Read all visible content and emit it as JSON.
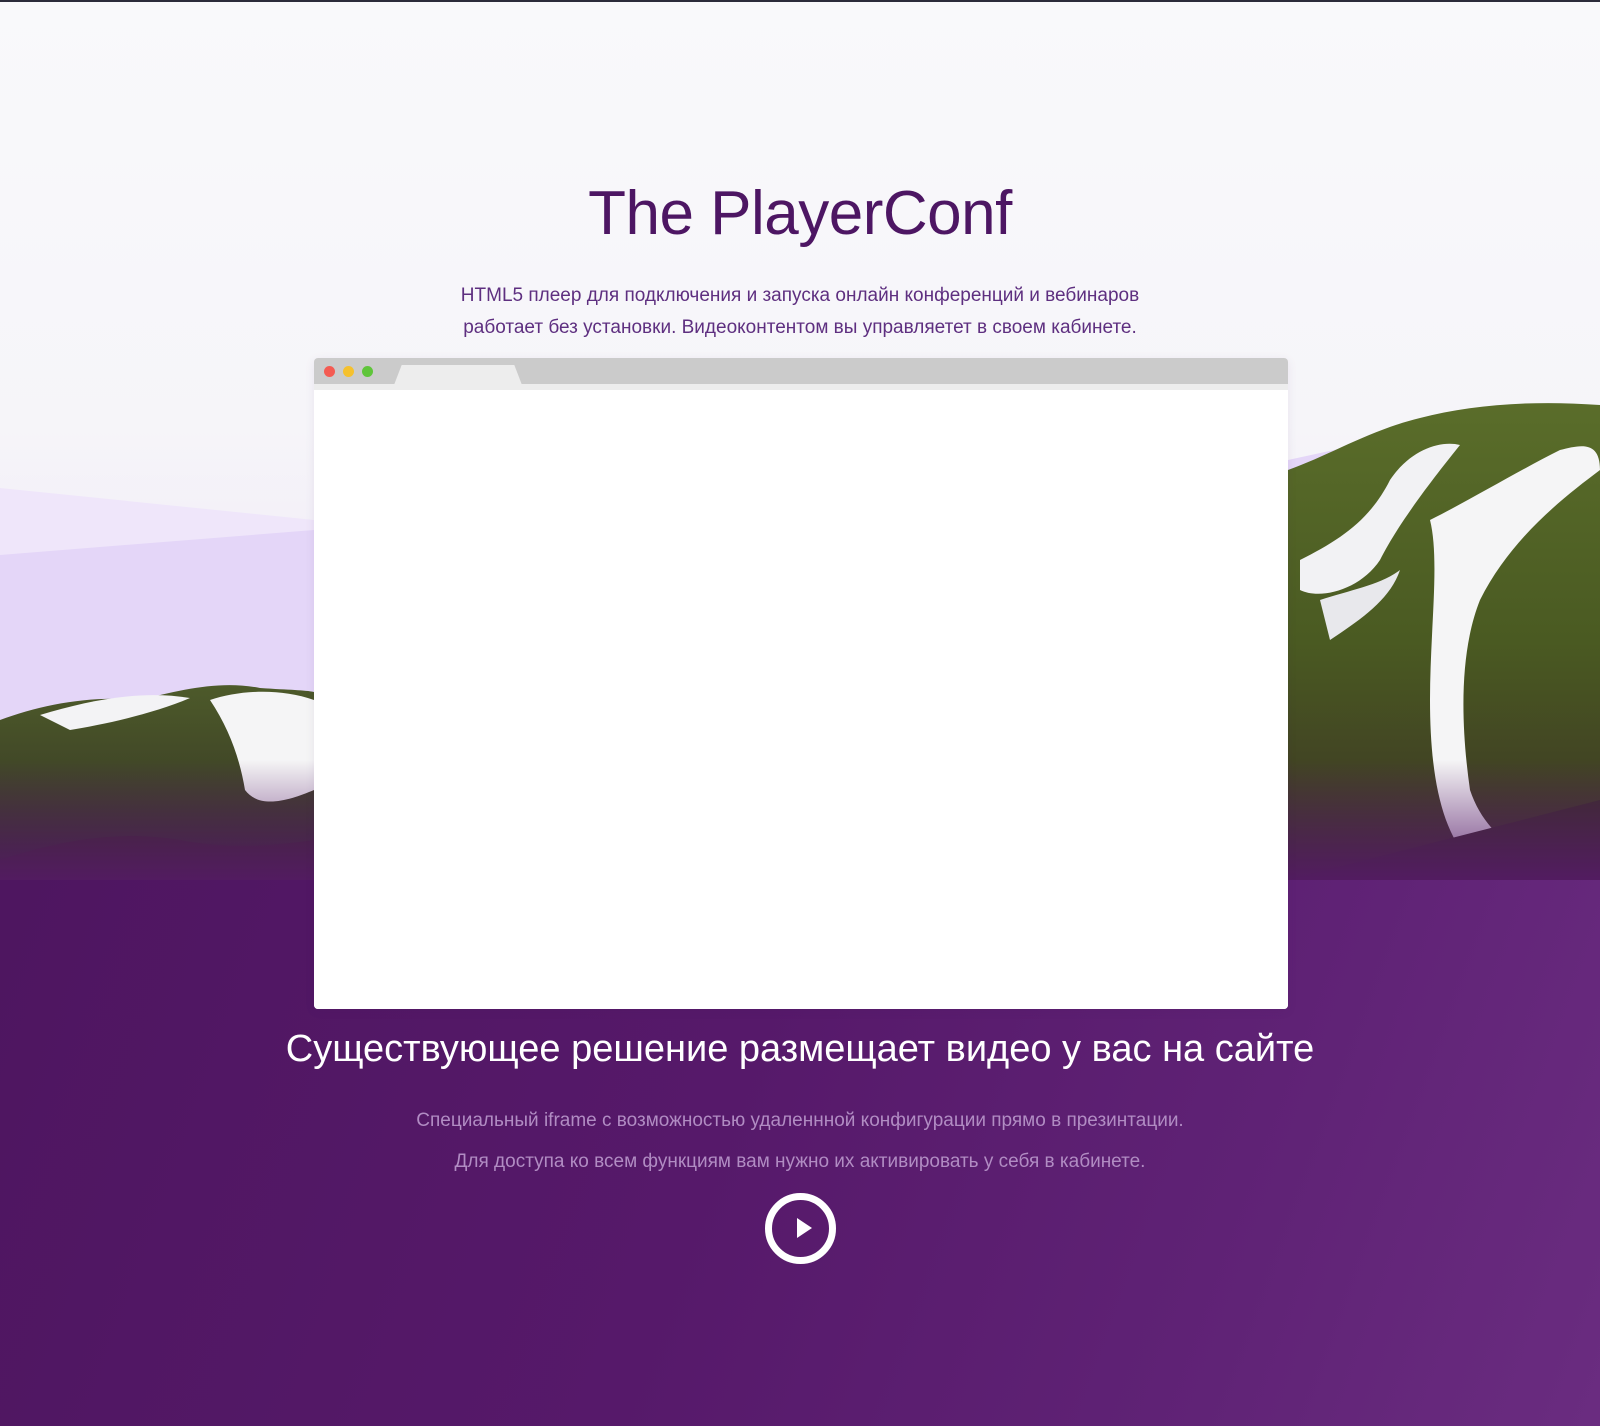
{
  "hero": {
    "title": "The PlayerConf",
    "subtitle_line1": "HTML5 плеер для подключения и запуска онлайн конференций и вебинаров",
    "subtitle_line2": "работает без установки. Видеоконтентом вы управляетет в своем кабинете."
  },
  "browser_mockup": {
    "window_buttons": [
      "close",
      "minimize",
      "maximize"
    ],
    "colors": {
      "close": "#f45b52",
      "minimize": "#f5c12e",
      "maximize": "#5fc53a"
    }
  },
  "section": {
    "heading": "Существующее решение размещает видео у вас на сайте",
    "description_line1": "Специальный iframe с возможностью удаленнной конфигурации прямо в презинтации.",
    "description_line2": "Для доступа ко всем функциям вам нужно их активировать у себя в кабинете.",
    "play_icon": "play-circle-icon"
  },
  "colors": {
    "brand_purple": "#4d1663",
    "band_purple": "#56196a",
    "muted_text": "#b18cc3"
  }
}
